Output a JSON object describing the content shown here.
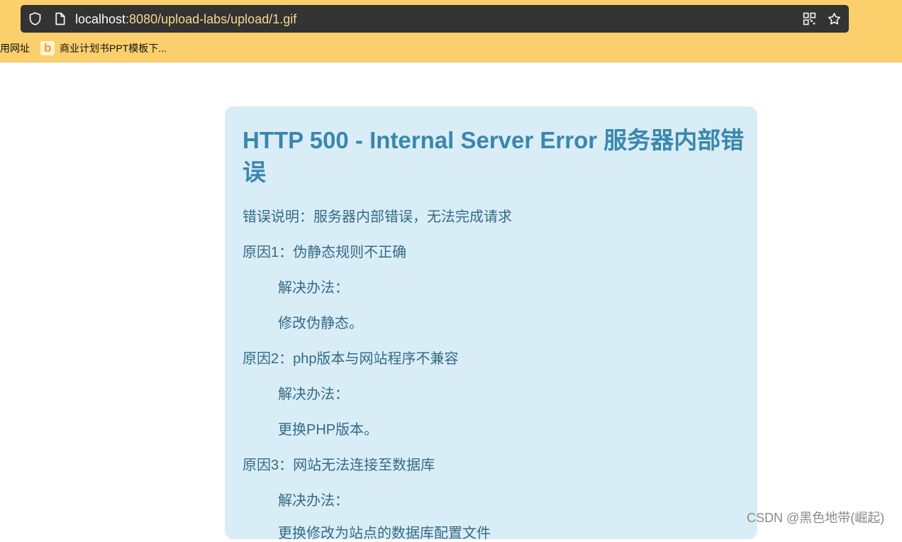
{
  "browser": {
    "url": {
      "host": "localhost",
      "path": ":8080/upload-labs/upload/1.gif"
    },
    "icons": {
      "shield": "shield-icon",
      "page": "page-icon",
      "qr": "qr-code-icon",
      "star": "star-icon"
    },
    "bookmarks": [
      {
        "label": "用网址"
      },
      {
        "label": "商业计划书PPT模板下..."
      }
    ],
    "colors": {
      "toolbar": "#fbd06c",
      "addressBar": "#333333"
    }
  },
  "error_card": {
    "title": "HTTP 500 - Internal Server Error 服务器内部错误",
    "lines": [
      "错误说明：服务器内部错误，无法完成请求",
      "原因1：伪静态规则不正确",
      "解决办法：",
      "修改伪静态。",
      "原因2：php版本与网站程序不兼容",
      "解决办法：",
      "更换PHP版本。",
      "原因3：网站无法连接至数据库",
      "解决办法：",
      "更换修改为站点的数据库配置文件"
    ],
    "colors": {
      "background": "#d9edf7",
      "title": "#3a87ad",
      "text": "#346b86"
    }
  },
  "watermark": "CSDN @黑色地带(崛起)"
}
